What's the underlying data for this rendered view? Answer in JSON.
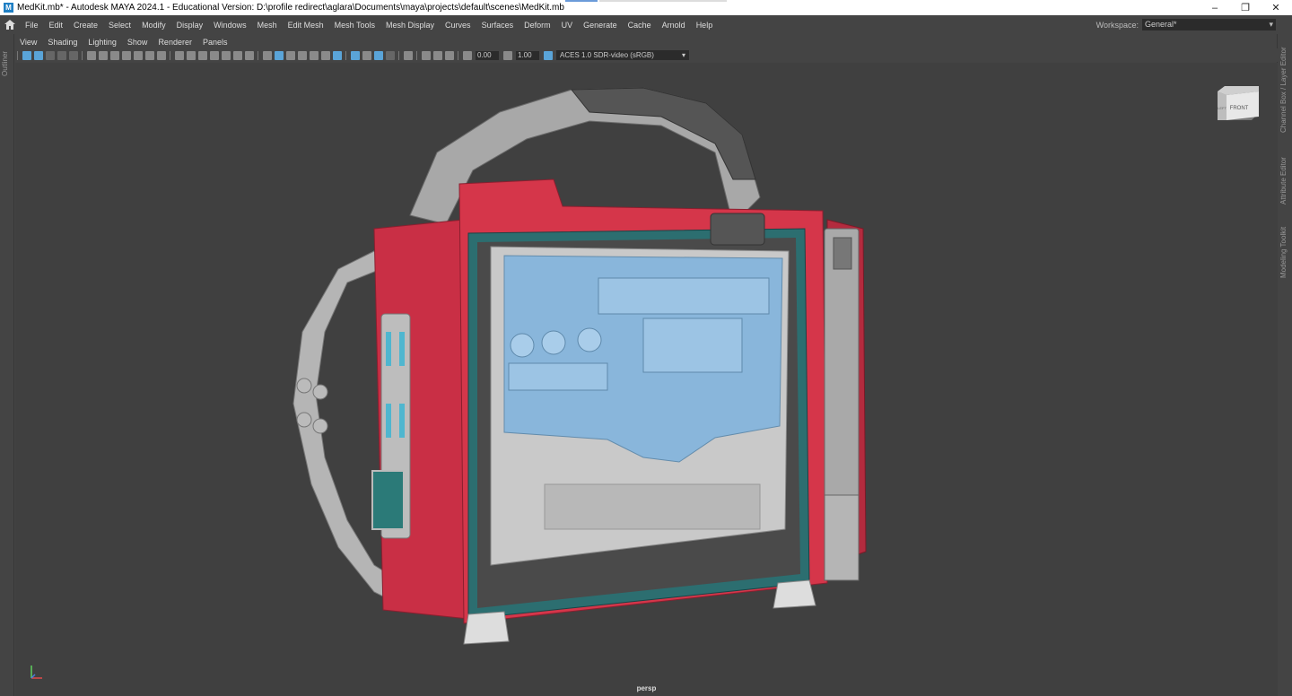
{
  "window": {
    "title": "MedKit.mb* - Autodesk MAYA 2024.1 - Educational Version: D:\\profile redirect\\aglara\\Documents\\maya\\projects\\default\\scenes\\MedKit.mb",
    "app_icon": "maya-icon",
    "minimize": "–",
    "restore": "❐",
    "close": "✕"
  },
  "menubar": {
    "items": [
      "File",
      "Edit",
      "Create",
      "Select",
      "Modify",
      "Display",
      "Windows",
      "Mesh",
      "Edit Mesh",
      "Mesh Tools",
      "Mesh Display",
      "Curves",
      "Surfaces",
      "Deform",
      "UV",
      "Generate",
      "Cache",
      "Arnold",
      "Help"
    ],
    "workspace_label": "Workspace:",
    "workspace_value": "General*"
  },
  "side_panels": {
    "left": "Outliner",
    "right": [
      "Channel Box / Layer Editor",
      "Attribute Editor",
      "Modeling Toolkit"
    ]
  },
  "panel_menu": [
    "View",
    "Shading",
    "Lighting",
    "Show",
    "Renderer",
    "Panels"
  ],
  "toolbar": {
    "exposure": "0.00",
    "gamma": "1.00",
    "color_space": "ACES 1.0 SDR-video (sRGB)"
  },
  "viewport": {
    "camera": "persp",
    "viewcube_face": "FRONT",
    "viewcube_side": "LEFT"
  },
  "colors": {
    "viewport_bg": "#404040",
    "ui_bg": "#444444",
    "accent": "#5aa4d8",
    "medkit_red": "#d5364a",
    "medkit_glass": "#86b6dc"
  }
}
